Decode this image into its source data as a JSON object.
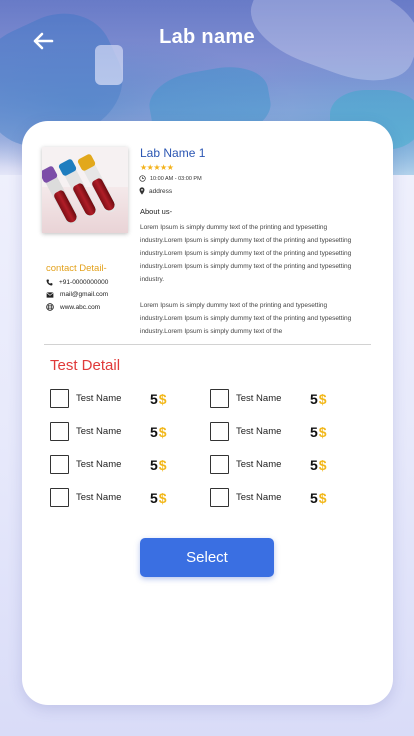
{
  "header": {
    "title": "Lab name",
    "back_icon": "arrow-left-icon"
  },
  "lab": {
    "name": "Lab Name 1",
    "rating_stars": "★★★★★",
    "rating": 5,
    "hours": "10:00 AM - 03:00 PM",
    "address": "address",
    "photo_icon": "blood-sample-tubes"
  },
  "about": {
    "title": "About us-",
    "paragraph1": "Lorem Ipsum is simply dummy text of the printing and typesetting industry.Lorem Ipsum is simply dummy text of the printing and typesetting industry.Lorem Ipsum is simply dummy text of the printing and typesetting industry.Lorem Ipsum is simply dummy text of the printing and typesetting industry.",
    "paragraph2": "Lorem Ipsum is simply dummy text of the printing and typesetting industry.Lorem Ipsum is simply dummy text of the printing and typesetting industry.Lorem Ipsum is simply dummy text of the"
  },
  "contact": {
    "title": "contact Detail-",
    "phone": "+91-0000000000",
    "email": "mail@gmail.com",
    "website": "www.abc.com"
  },
  "tests": {
    "title": "Test Detail",
    "items": [
      {
        "name": "Test Name",
        "price": "5",
        "currency": "$"
      },
      {
        "name": "Test Name",
        "price": "5",
        "currency": "$"
      },
      {
        "name": "Test Name",
        "price": "5",
        "currency": "$"
      },
      {
        "name": "Test Name",
        "price": "5",
        "currency": "$"
      },
      {
        "name": "Test Name",
        "price": "5",
        "currency": "$"
      },
      {
        "name": "Test Name",
        "price": "5",
        "currency": "$"
      },
      {
        "name": "Test Name",
        "price": "5",
        "currency": "$"
      },
      {
        "name": "Test Name",
        "price": "5",
        "currency": "$"
      }
    ]
  },
  "actions": {
    "select_label": "Select"
  },
  "colors": {
    "primary": "#3a6fe2",
    "lab_name": "#2b56b3",
    "contact_title": "#e3a11b",
    "test_title": "#e03a3a",
    "currency": "#f2b81c",
    "stars": "#f3b21b"
  }
}
